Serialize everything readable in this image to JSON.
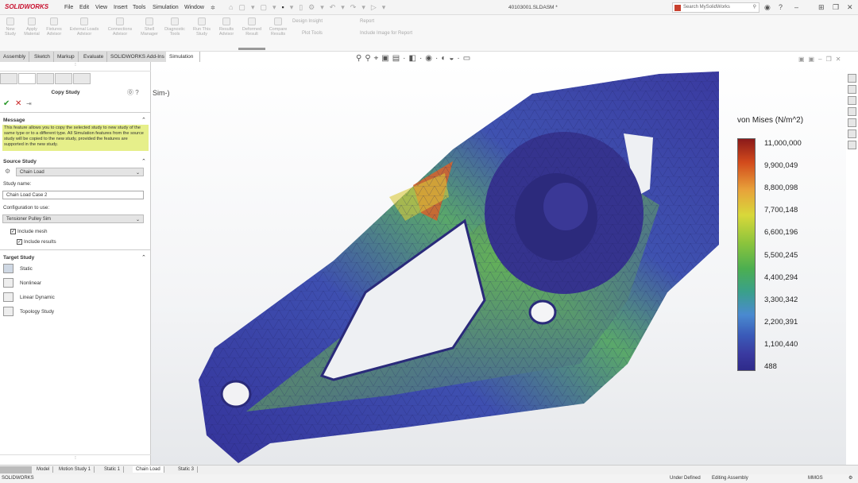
{
  "app": {
    "logo": "SOLIDWORKS",
    "document_title": "40103001.SLDASM *",
    "search_placeholder": "Search MySolidWorks"
  },
  "menu": [
    "File",
    "Edit",
    "View",
    "Insert",
    "Tools",
    "Simulation",
    "Window"
  ],
  "ribbon": [
    {
      "label": "New Study"
    },
    {
      "label": "Apply Material"
    },
    {
      "label": "Fixtures Advisor"
    },
    {
      "label": "External Loads Advisor"
    },
    {
      "label": "Connections Advisor"
    },
    {
      "label": "Shell Manager"
    },
    {
      "label": "Diagnostic Tools"
    },
    {
      "label": "Run This Study"
    },
    {
      "label": "Results Advisor"
    },
    {
      "label": "Deformed Result"
    },
    {
      "label": "Compare Results"
    }
  ],
  "ribbon_small": [
    "Design Insight",
    "Plot Tools",
    "Report",
    "Include Image for Report"
  ],
  "command_tabs": [
    "Assembly",
    "Sketch",
    "Markup",
    "Evaluate",
    "SOLIDWORKS Add-Ins",
    "Simulation"
  ],
  "active_command_tab": "Simulation",
  "panel": {
    "title": "Copy Study",
    "message_header": "Message",
    "message": "This feature allows you to copy the selected study to new study of the same type or to a different type. All Simulation features from the source study will be copied to the new study, provided the features are supported in the new study.",
    "source_header": "Source Study",
    "source_value": "Chain Load",
    "study_name_label": "Study name:",
    "study_name_value": "Chain Load Case 2",
    "config_label": "Configuration to use:",
    "config_value": "Tensioner Pulley Sim",
    "include_mesh": {
      "label": "Include mesh",
      "checked": true
    },
    "include_results": {
      "label": "Include results",
      "checked": true
    },
    "target_header": "Target Study",
    "targets": [
      "Static",
      "Nonlinear",
      "Linear Dynamic",
      "Topology Study"
    ]
  },
  "viewport": {
    "partial_label": "Sim-)"
  },
  "legend": {
    "title": "von Mises (N/m^2)",
    "values": [
      "11,000,000",
      "9,900,049",
      "8,800,098",
      "7,700,148",
      "6,600,196",
      "5,500,245",
      "4,400,294",
      "3,300,342",
      "2,200,391",
      "1,100,440",
      "488"
    ],
    "colors": [
      "#8b1a1a",
      "#d24a1c",
      "#e8a23a",
      "#d8d83a",
      "#8cc43c",
      "#4caf50",
      "#3aa08a",
      "#4a8ad0",
      "#3a5ab8",
      "#3a3aa0",
      "#2e2a8a"
    ]
  },
  "bottom_tabs": [
    "Model",
    "Motion Study 1",
    "Static 1",
    "Chain Load",
    "Static 3"
  ],
  "active_bottom_tab": "Chain Load",
  "status": {
    "app": "SOLIDWORKS",
    "state": "Under Defined",
    "mode": "Editing Assembly",
    "units": "MMGS"
  }
}
